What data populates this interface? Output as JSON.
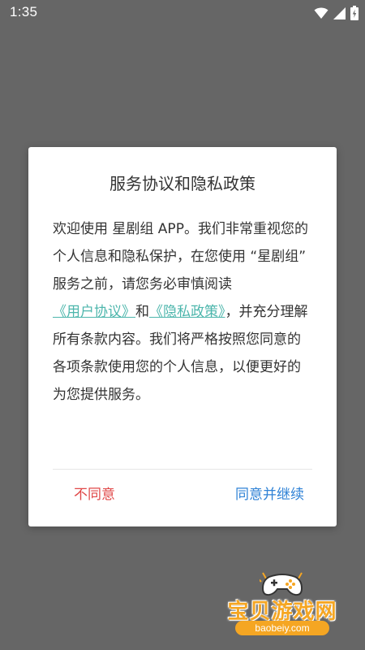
{
  "status_bar": {
    "time": "1:35",
    "icons": [
      "wifi-icon",
      "signal-icon",
      "battery-charging-icon"
    ]
  },
  "dialog": {
    "title": "服务协议和隐私政策",
    "body": {
      "text_1": "欢迎使用 星剧组 APP。我们非常重视您的个人信息和隐私保护，在您使用 “星剧组” 服务之前，请您务必审慎阅读",
      "link_user_agreement": "《用户协议》",
      "text_2": "和",
      "link_privacy_policy": "《隐私政策》",
      "text_3": "，并充分理解所有条款内容。我们将严格按照您同意的各项条款使用您的个人信息，以便更好的为您提供服务。"
    },
    "buttons": {
      "disagree": "不同意",
      "agree": "同意并继续"
    }
  },
  "watermark": {
    "name": "宝贝游戏网",
    "url": "baobeiy.com",
    "icon": "gamepad-icon"
  },
  "colors": {
    "overlay": "#666666",
    "link": "#4db6ac",
    "disagree": "#e04848",
    "agree": "#2f82d6",
    "watermark": "#f5a623"
  }
}
